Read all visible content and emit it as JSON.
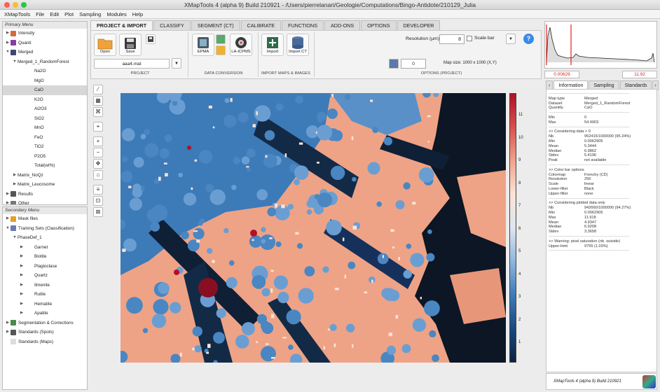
{
  "window": {
    "title": "XMapTools 4 (alpha 9) Build 210921 - /Users/pierrelanari/Geologie/Computations/Bingo-Antidote/210129_Julia"
  },
  "menu": [
    "XMapTools",
    "File",
    "Edit",
    "Plot",
    "Sampling",
    "Modules",
    "Help"
  ],
  "primary_menu": {
    "title": "Primary Menu",
    "items": [
      {
        "label": "Intensity",
        "level": 0,
        "arrow": "▶",
        "icon": "intensity-icon",
        "color": "#d66a3a"
      },
      {
        "label": "Quanti",
        "level": 0,
        "arrow": "▶",
        "icon": "quanti-icon",
        "color": "#8a3aa8"
      },
      {
        "label": "Merged",
        "level": 0,
        "arrow": "▼",
        "icon": "merged-icon",
        "color": "#3b4a6e"
      },
      {
        "label": "Merged_1_RandomForest",
        "level": 1,
        "arrow": "▼",
        "icon": "",
        "color": ""
      },
      {
        "label": "Na2O",
        "level": 2,
        "arrow": "",
        "icon": "",
        "color": ""
      },
      {
        "label": "MgO",
        "level": 2,
        "arrow": "",
        "icon": "",
        "color": ""
      },
      {
        "label": "CaO",
        "level": 2,
        "arrow": "",
        "icon": "",
        "color": "",
        "selected": true
      },
      {
        "label": "K2O",
        "level": 2,
        "arrow": "",
        "icon": "",
        "color": ""
      },
      {
        "label": "Al2O3",
        "level": 2,
        "arrow": "",
        "icon": "",
        "color": ""
      },
      {
        "label": "SiO2",
        "level": 2,
        "arrow": "",
        "icon": "",
        "color": ""
      },
      {
        "label": "MnO",
        "level": 2,
        "arrow": "",
        "icon": "",
        "color": ""
      },
      {
        "label": "FeO",
        "level": 2,
        "arrow": "",
        "icon": "",
        "color": ""
      },
      {
        "label": "TiO2",
        "level": 2,
        "arrow": "",
        "icon": "",
        "color": ""
      },
      {
        "label": "P2O5",
        "level": 2,
        "arrow": "",
        "icon": "",
        "color": ""
      },
      {
        "label": "Total(wt%)",
        "level": 2,
        "arrow": "",
        "icon": "",
        "color": ""
      },
      {
        "label": "Matrix_NoQz",
        "level": 1,
        "arrow": "▶",
        "icon": "",
        "color": ""
      },
      {
        "label": "Matrix_Leucosome",
        "level": 1,
        "arrow": "▶",
        "icon": "",
        "color": ""
      },
      {
        "label": "Results",
        "level": 0,
        "arrow": "▶",
        "icon": "results-icon",
        "color": "#555"
      },
      {
        "label": "Other",
        "level": 0,
        "arrow": "▶",
        "icon": "other-icon",
        "color": "#777"
      }
    ]
  },
  "secondary_menu": {
    "title": "Secondary Menu",
    "items": [
      {
        "label": "Mask files",
        "level": 0,
        "arrow": "▶",
        "icon": "mask-icon",
        "color": "#e8a020"
      },
      {
        "label": "Training Sets (Classification)",
        "level": 0,
        "arrow": "▼",
        "icon": "training-icon",
        "color": "#6a7ab8"
      },
      {
        "label": "PhaseDef_1",
        "level": 1,
        "arrow": "▼",
        "icon": "",
        "color": ""
      },
      {
        "label": "Garnet",
        "level": 2,
        "arrow": "▶",
        "icon": "",
        "color": ""
      },
      {
        "label": "Biotite",
        "level": 2,
        "arrow": "▶",
        "icon": "",
        "color": ""
      },
      {
        "label": "Plagioclase",
        "level": 2,
        "arrow": "▶",
        "icon": "",
        "color": ""
      },
      {
        "label": "Quartz",
        "level": 2,
        "arrow": "▶",
        "icon": "",
        "color": ""
      },
      {
        "label": "Ilmenite",
        "level": 2,
        "arrow": "▶",
        "icon": "",
        "color": ""
      },
      {
        "label": "Rutile",
        "level": 2,
        "arrow": "▶",
        "icon": "",
        "color": ""
      },
      {
        "label": "Hematite",
        "level": 2,
        "arrow": "▶",
        "icon": "",
        "color": ""
      },
      {
        "label": "Apatite",
        "level": 2,
        "arrow": "▶",
        "icon": "",
        "color": ""
      },
      {
        "label": "Segmentation & Corrections",
        "level": 0,
        "arrow": "▶",
        "icon": "segmentation-icon",
        "color": "#4a8a4a"
      },
      {
        "label": "Standards (Spots)",
        "level": 0,
        "arrow": "▶",
        "icon": "spots-icon",
        "color": "#555"
      },
      {
        "label": "Standards (Maps)",
        "level": 0,
        "arrow": "",
        "icon": "maps-icon",
        "color": "#ddd"
      }
    ]
  },
  "tabs": [
    "PROJECT & IMPORT",
    "CLASSIFY",
    "SEGMENT (CT)",
    "CALIBRATE",
    "FUNCTIONS",
    "ADD-ONS",
    "OPTIONS",
    "DEVELOPER"
  ],
  "ribbon": {
    "open": "Open",
    "save": "Save",
    "project_file": "aaa4.mat",
    "project_section": "PROJECT",
    "epma": "EPMA",
    "laicpms": "LA-ICPMS",
    "conversion_section": "DATA CONVERSION",
    "import": "Import",
    "import_ct": "Import CT",
    "import_section": "IMPORT MAPS & IMAGES",
    "resolution_label": "Resolution (µm)",
    "resolution_value": "8",
    "scale_bar": "Scale bar",
    "map_size": "Map size: 1000 x 1000 (X,Y)",
    "counter": "0",
    "options_section": "OPTIONS (PROJECT)"
  },
  "colorbar": {
    "ticks": [
      "11",
      "10",
      "9",
      "8",
      "7",
      "6",
      "5",
      "4",
      "3",
      "2",
      "1"
    ],
    "palette": [
      "#b10f2a",
      "#d8514a",
      "#f0a48b",
      "#fbe3d6",
      "#dce6f0",
      "#8fb6dd",
      "#3d7ab8",
      "#1a4a7e",
      "#0c2240"
    ]
  },
  "histogram": {
    "min_value": "0.00629",
    "max_value": "11.92"
  },
  "info_tabs": [
    "Information",
    "Sampling",
    "Standards"
  ],
  "info": {
    "rows1": [
      [
        "Map type",
        "Merged"
      ],
      [
        "Dataset",
        "Merged_1_RandomForest"
      ],
      [
        "Quantity",
        "CaO"
      ]
    ],
    "rows2": [
      [
        "Min",
        "0"
      ],
      [
        "Max",
        "54.4903"
      ]
    ],
    "section1": ">> Considering data > 0",
    "rows3": [
      [
        "Nb",
        "952415/1000000 (95.24%)"
      ],
      [
        "Min",
        "0.0062905"
      ],
      [
        "Mean",
        "5.3444"
      ],
      [
        "Median",
        "6.9862"
      ],
      [
        "Stdev",
        "5.4196"
      ],
      [
        "Peak",
        "not available"
      ]
    ],
    "section2": ">> Color bar options",
    "rows4": [
      [
        "Colormap",
        "Frenchy (CD)"
      ],
      [
        "Resolution",
        "256"
      ],
      [
        "Scale",
        "linear"
      ],
      [
        "Lower-filter",
        "Black"
      ],
      [
        "Upper-filter",
        "none"
      ]
    ],
    "section3": ">> Considering plotted data only",
    "rows5": [
      [
        "Nb",
        "942660/1000000 (94.27%)"
      ],
      [
        "Min",
        "0.0062905"
      ],
      [
        "Max",
        "11.918"
      ],
      [
        "Mean",
        "4.9347"
      ],
      [
        "Median",
        "6.9208"
      ],
      [
        "Stdev",
        "3.3658"
      ]
    ],
    "section4": ">> Warning: pixel saturation (nb. outside)",
    "rows6": [
      [
        "Upper-limit",
        "9755 (1.03%)"
      ]
    ]
  },
  "footer": "XMapTools 4 (alpha 9) Build 210921"
}
